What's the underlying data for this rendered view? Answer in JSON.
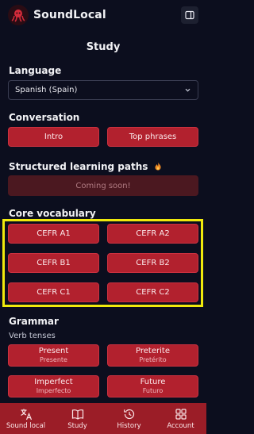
{
  "app": {
    "title": "SoundLocal"
  },
  "page": {
    "title": "Study"
  },
  "language": {
    "heading": "Language",
    "selected": "Spanish (Spain)"
  },
  "conversation": {
    "heading": "Conversation",
    "buttons": [
      "Intro",
      "Top phrases"
    ]
  },
  "paths": {
    "heading": "Structured learning paths",
    "status": "Coming soon!"
  },
  "vocabulary": {
    "heading": "Core vocabulary",
    "levels": [
      "CEFR A1",
      "CEFR A2",
      "CEFR B1",
      "CEFR B2",
      "CEFR C1",
      "CEFR C2"
    ]
  },
  "grammar": {
    "heading": "Grammar",
    "subheading": "Verb tenses",
    "tenses": [
      {
        "label": "Present",
        "native": "Presente"
      },
      {
        "label": "Preterite",
        "native": "Pretérito"
      },
      {
        "label": "Imperfect",
        "native": "Imperfecto"
      },
      {
        "label": "Future",
        "native": "Futuro"
      }
    ]
  },
  "nav": {
    "items": [
      {
        "label": "Sound local",
        "icon": "translate-icon"
      },
      {
        "label": "Study",
        "icon": "book-icon"
      },
      {
        "label": "History",
        "icon": "history-icon"
      },
      {
        "label": "Account",
        "icon": "grid-icon"
      }
    ]
  },
  "colors": {
    "background": "#0c0e1e",
    "accent": "#b2212e",
    "highlight": "#f0e90c"
  }
}
